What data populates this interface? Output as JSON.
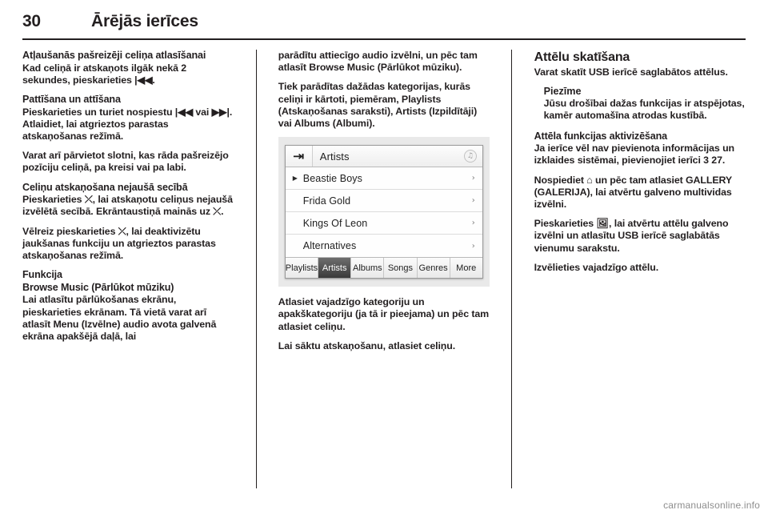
{
  "header": {
    "page_number": "30",
    "chapter_title": "Ārējās ierīces"
  },
  "column1": {
    "heading1": "Atļaušanās pašreizēji celiņa atlasīšanai",
    "para1": "Kad celiņā ir atskaņots ilgāk nekā 2 sekundes, pieskarieties |◀◀.",
    "heading2": "Pattīšana un attīšana",
    "para2": "Pieskarieties un turiet nospiestu |◀◀ vai ▶▶|. Atlaidiet, lai atgrieztos parastas atskaņošanas režīmā.",
    "para3": "Varat arī pārvietot slotni, kas rāda pašreizējo pozīciju celiņā, pa kreisi vai pa labi.",
    "heading3": "Celiņu atskaņošana nejaušā secībā",
    "para4": "Pieskarieties ⤫, lai atskaņotu celiņus nejaušā izvēlētā secībā. Ekrāntaustiņā mainās uz ⤫.",
    "para5": "Vēlreiz pieskarieties ⤫, lai deaktivizētu jaukšanas funkciju un atgrieztos parastas atskaņošanas režīmā.",
    "heading4": "Funkcija",
    "heading5": "Browse Music (Pārlūkot mūziku)",
    "para6": "Lai atlasītu pārlūkošanas ekrānu, pieskarieties ekrānam. Tā vietā varat arī atlasīt Menu (Izvēlne) audio avota galvenā ekrāna apakšējā daļā, lai"
  },
  "column2": {
    "para1": "parādītu attiecīgo audio izvēlni, un pēc tam atlasīt Browse Music (Pārlūkot mūziku).",
    "para2": "Tiek parādītas dažādas kategorijas, kurās celiņi ir kārtoti, piemēram, Playlists (Atskaņošanas saraksti), Artists (Izpildītāji) vai Albums (Albumi).",
    "figure": {
      "title": "Artists",
      "back_icon": "back-arrow-icon",
      "note_icon": "music-note-icon",
      "rows": [
        {
          "label": "Beastie Boys",
          "expandable": true
        },
        {
          "label": "Frida Gold",
          "expandable": false
        },
        {
          "label": "Kings Of Leon",
          "expandable": false
        },
        {
          "label": "Alternatives",
          "expandable": false
        }
      ],
      "tabs": [
        {
          "label": "Playlists",
          "active": false
        },
        {
          "label": "Artists",
          "active": true
        },
        {
          "label": "Albums",
          "active": false
        },
        {
          "label": "Songs",
          "active": false
        },
        {
          "label": "Genres",
          "active": false
        },
        {
          "label": "More",
          "active": false
        }
      ]
    },
    "para3": "Atlasiet vajadzīgo kategoriju un apakškategoriju (ja tā ir pieejama) un pēc tam atlasiet celiņu.",
    "para4": "Lai sāktu atskaņošanu, atlasiet celiņu."
  },
  "column3": {
    "heading1": "Attēlu skatīšana",
    "para1": "Varat skatīt USB ierīcē saglabātos attēlus.",
    "note_heading": "Piezīme",
    "note_body": "Jūsu drošībai dažas funkcijas ir atspējotas, kamēr automašīna atrodas kustībā.",
    "heading2": "Attēla funkcijas aktivizēšana",
    "para2": "Ja ierīce vēl nav pievienota informācijas un izklaides sistēmai, pievienojiet ierīci 3 27.",
    "para3": "Nospiediet ⌂ un pēc tam atlasiet GALLERY (GALERIJA), lai atvērtu galveno multividas izvēlni.",
    "para4": "Pieskarieties 🖼, lai atvērtu attēlu galveno izvēlni un atlasītu USB ierīcē saglabātās vienumu sarakstu.",
    "para5": "Izvēlieties vajadzīgo attēlu."
  },
  "watermark": "carmanualsonline.info"
}
